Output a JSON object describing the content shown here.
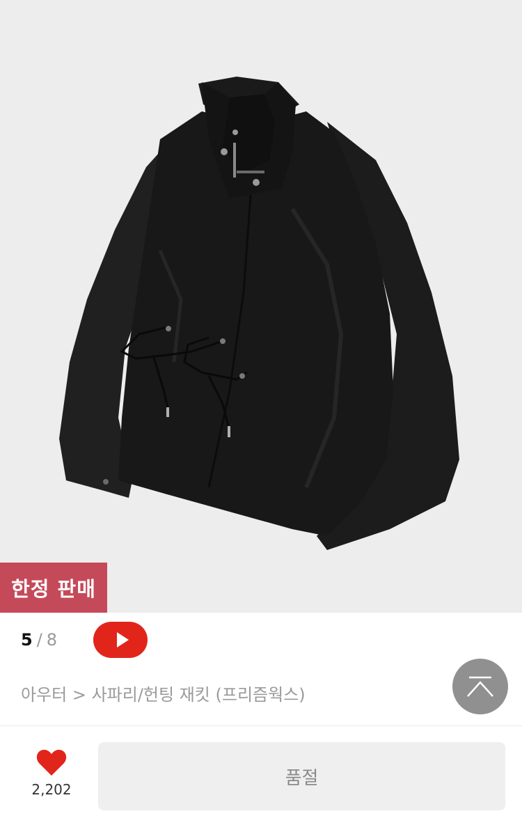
{
  "product": {
    "badge_label": "한정 판매",
    "image_alt": "black-safari-jacket-photo"
  },
  "gallery": {
    "current": "5",
    "separator": "/",
    "total": "8"
  },
  "video_button": {
    "icon": "play-icon",
    "color": "#e1251b"
  },
  "breadcrumb": {
    "text": "아우터 > 사파리/헌팅 재킷 (프리즘웍스)"
  },
  "scroll_top_button": {
    "icon": "scroll-to-top-icon"
  },
  "footer": {
    "like_icon": "heart-icon",
    "like_color": "#e1251b",
    "like_count": "2,202",
    "soldout_label": "품절"
  },
  "colors": {
    "badge": "#c44a5a",
    "hero_background": "#ededed"
  }
}
